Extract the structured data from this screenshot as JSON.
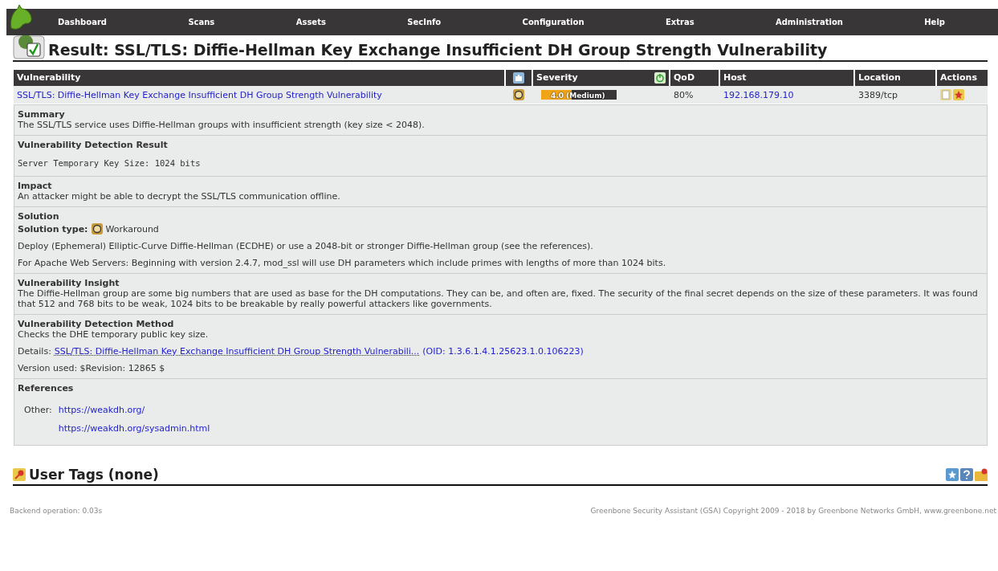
{
  "nav": [
    {
      "label": "Dashboard"
    },
    {
      "label": "Scans"
    },
    {
      "label": "Assets"
    },
    {
      "label": "SecInfo"
    },
    {
      "label": "Configuration"
    },
    {
      "label": "Extras"
    },
    {
      "label": "Administration"
    },
    {
      "label": "Help"
    }
  ],
  "title": "Result: SSL/TLS: Diffie-Hellman Key Exchange Insufficient DH Group Strength Vulnerability",
  "table": {
    "columns": [
      "Vulnerability",
      "Severity",
      "QoD",
      "Host",
      "Location",
      "Actions"
    ],
    "row": {
      "vulnerability": "SSL/TLS: Diffie-Hellman Key Exchange Insufficient DH Group Strength Vulnerability",
      "severity": {
        "level": 0.4,
        "reading": "4.0 (Medium)"
      },
      "qod": "80%",
      "host": "192.168.179.10",
      "location": "3389/tcp"
    }
  },
  "sections": [
    {
      "kind": "text",
      "heading": "Summary",
      "lines": [
        "The SSL/TLS service uses Diffie-Hellman groups with insufficient strength (key size < 2048)."
      ]
    },
    {
      "kind": "code",
      "heading": "Vulnerability Detection Result",
      "lines": [
        "Server Temporary Key Size: 1024 bits"
      ]
    },
    {
      "kind": "text",
      "heading": "Impact",
      "lines": [
        "An attacker might be able to decrypt the SSL/TLS communication offline."
      ]
    },
    {
      "kind": "solution",
      "heading": "Solution",
      "solution_type_label": "Solution type:",
      "solution_type": "Workaround",
      "lines": [
        "Deploy (Ephemeral) Elliptic-Curve Diffie-Hellman (ECDHE) or use a 2048-bit or stronger Diffie-Hellman group (see the references).",
        "For Apache Web Servers: Beginning with version 2.4.7, mod_ssl will use DH parameters which include primes with lengths of more than 1024 bits."
      ]
    },
    {
      "kind": "text",
      "heading": "Vulnerability Insight",
      "lines": [
        "The Diffie-Hellman group are some big numbers that are used as base for the DH computations. They can be, and often are, fixed. The security of the final secret depends on the size of these parameters. It was found that 512 and 768 bits to be weak, 1024 bits to be breakable by really powerful attackers like governments."
      ]
    },
    {
      "kind": "method",
      "heading": "Vulnerability Detection Method",
      "lines": [
        "Checks the DHE temporary public key size."
      ],
      "details_label": "Details:",
      "details_link": "SSL/TLS: Diffie-Hellman Key Exchange Insufficient DH Group Strength Vulnerabili...",
      "oid": "(OID: 1.3.6.1.4.1.25623.1.0.106223)",
      "version": "Version used: $Revision: 12865 $"
    },
    {
      "kind": "references",
      "heading": "References",
      "other_label": "Other:",
      "links": [
        "https://weakdh.org/",
        "https://weakdh.org/sysadmin.html"
      ]
    }
  ],
  "user_tags": "User Tags (none)",
  "footer": {
    "left": "Backend operation: 0.03s",
    "right": "Greenbone Security Assistant (GSA) Copyright 2009 - 2018 by Greenbone Networks GmbH, www.greenbone.net"
  }
}
